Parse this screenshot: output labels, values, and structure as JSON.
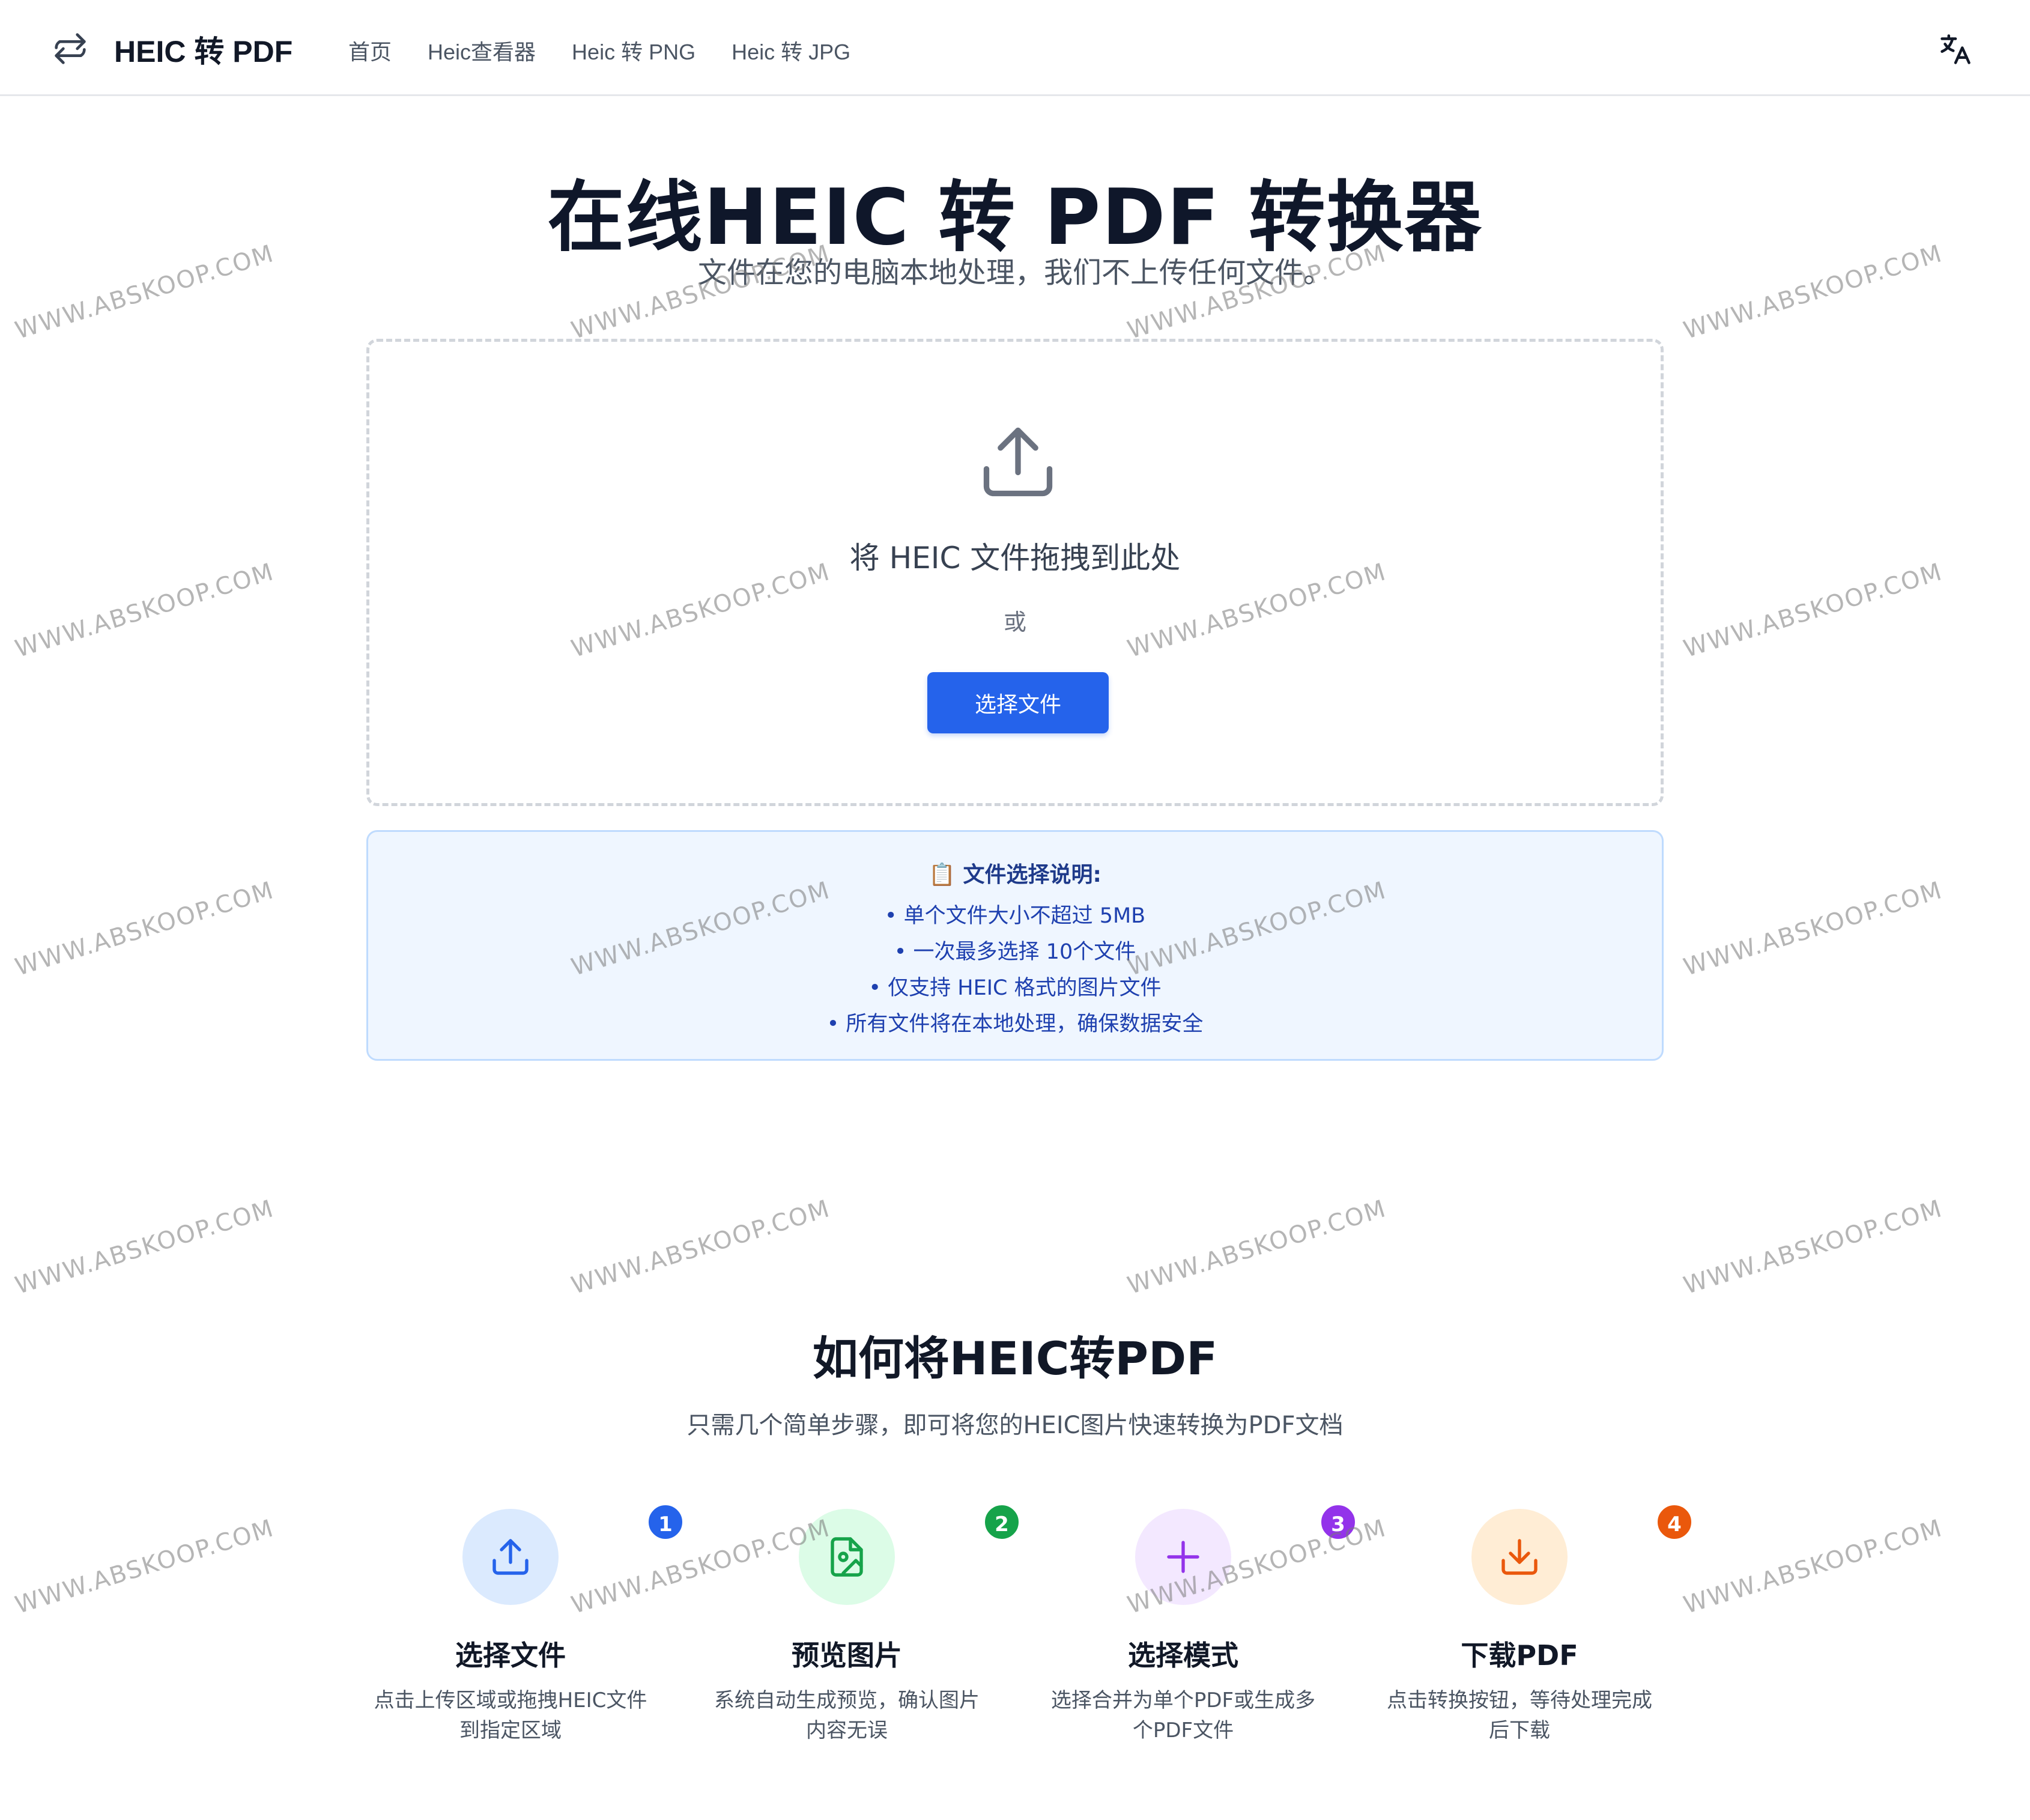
{
  "header": {
    "brand": "HEIC 转 PDF",
    "nav": [
      "首页",
      "Heic查看器",
      "Heic 转 PNG",
      "Heic 转 JPG"
    ]
  },
  "hero": {
    "title": "在线HEIC 转 PDF 转换器",
    "subtitle": "文件在您的电脑本地处理，我们不上传任何文件。"
  },
  "upload": {
    "drop_text": "将 HEIC 文件拖拽到此处",
    "or_text": "或",
    "button": "选择文件"
  },
  "info": {
    "title": "📋 文件选择说明:",
    "items": [
      "• 单个文件大小不超过 5MB",
      "• 一次最多选择 10个文件",
      "• 仅支持 HEIC 格式的图片文件",
      "• 所有文件将在本地处理，确保数据安全"
    ]
  },
  "howto": {
    "title": "如何将HEIC转PDF",
    "subtitle": "只需几个简单步骤，即可将您的HEIC图片快速转换为PDF文档",
    "steps": [
      {
        "num": "1",
        "title": "选择文件",
        "desc": "点击上传区域或拖拽HEIC文件到指定区域",
        "icon": "upload-icon",
        "color": "#2563eb",
        "bg": "#dbeafe"
      },
      {
        "num": "2",
        "title": "预览图片",
        "desc": "系统自动生成预览，确认图片内容无误",
        "icon": "image-file-icon",
        "color": "#16a34a",
        "bg": "#dcfce7"
      },
      {
        "num": "3",
        "title": "选择模式",
        "desc": "选择合并为单个PDF或生成多个PDF文件",
        "icon": "plus-icon",
        "color": "#9333ea",
        "bg": "#f3e8ff"
      },
      {
        "num": "4",
        "title": "下载PDF",
        "desc": "点击转换按钮，等待处理完成后下载",
        "icon": "download-icon",
        "color": "#ea580c",
        "bg": "#ffedd5"
      }
    ]
  },
  "watermark": "WWW.ABSKOOP.COM"
}
